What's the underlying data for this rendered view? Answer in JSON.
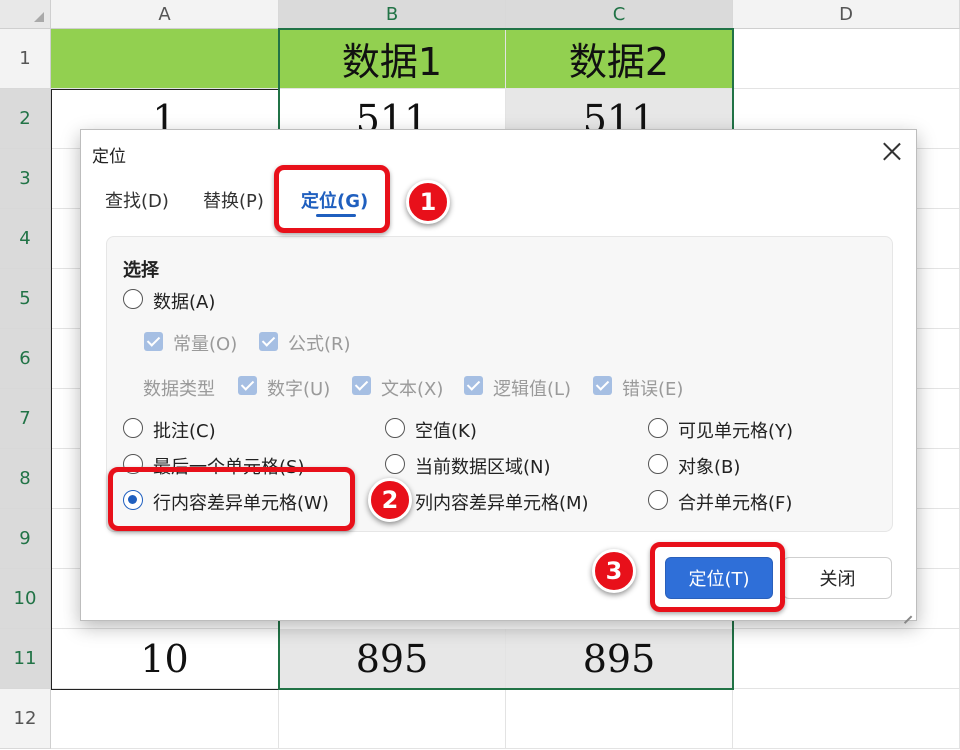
{
  "sheet": {
    "columns": [
      "A",
      "B",
      "C",
      "D"
    ],
    "rows": [
      "1",
      "2",
      "3",
      "4",
      "5",
      "6",
      "7",
      "8",
      "9",
      "10",
      "11",
      "12"
    ],
    "cells": {
      "b1": "数据1",
      "c1": "数据2",
      "a2": "1",
      "b2": "511",
      "c2": "511",
      "a11": "10",
      "b11": "895",
      "c11": "895"
    },
    "header_fill": "#92d050",
    "selection_color": "#217346"
  },
  "dialog": {
    "title": "定位",
    "close_icon": "close-icon",
    "tabs": [
      {
        "label": "查找(D)"
      },
      {
        "label": "替换(P)"
      },
      {
        "label": "定位(G)"
      }
    ],
    "active_tab": "定位(G)",
    "section_title": "选择",
    "options": {
      "data": "数据(A)",
      "constant": "常量(O)",
      "formula": "公式(R)",
      "data_type": "数据类型",
      "number": "数字(U)",
      "text": "文本(X)",
      "logical": "逻辑值(L)",
      "error": "错误(E)",
      "comment": "批注(C)",
      "blank": "空值(K)",
      "visible_cells": "可见单元格(Y)",
      "last_cell": "最后一个单元格(S)",
      "current_region": "当前数据区域(N)",
      "objects": "对象(B)",
      "row_diff": "行内容差异单元格(W)",
      "col_diff": "列内容差异单元格(M)",
      "merged": "合并单元格(F)"
    },
    "selected_option": "行内容差异单元格(W)",
    "buttons": {
      "locate": "定位(T)",
      "close": "关闭"
    },
    "accent": "#2f6fd8"
  },
  "annotations": {
    "badges": [
      "1",
      "2",
      "3"
    ],
    "color": "#e8101a"
  }
}
